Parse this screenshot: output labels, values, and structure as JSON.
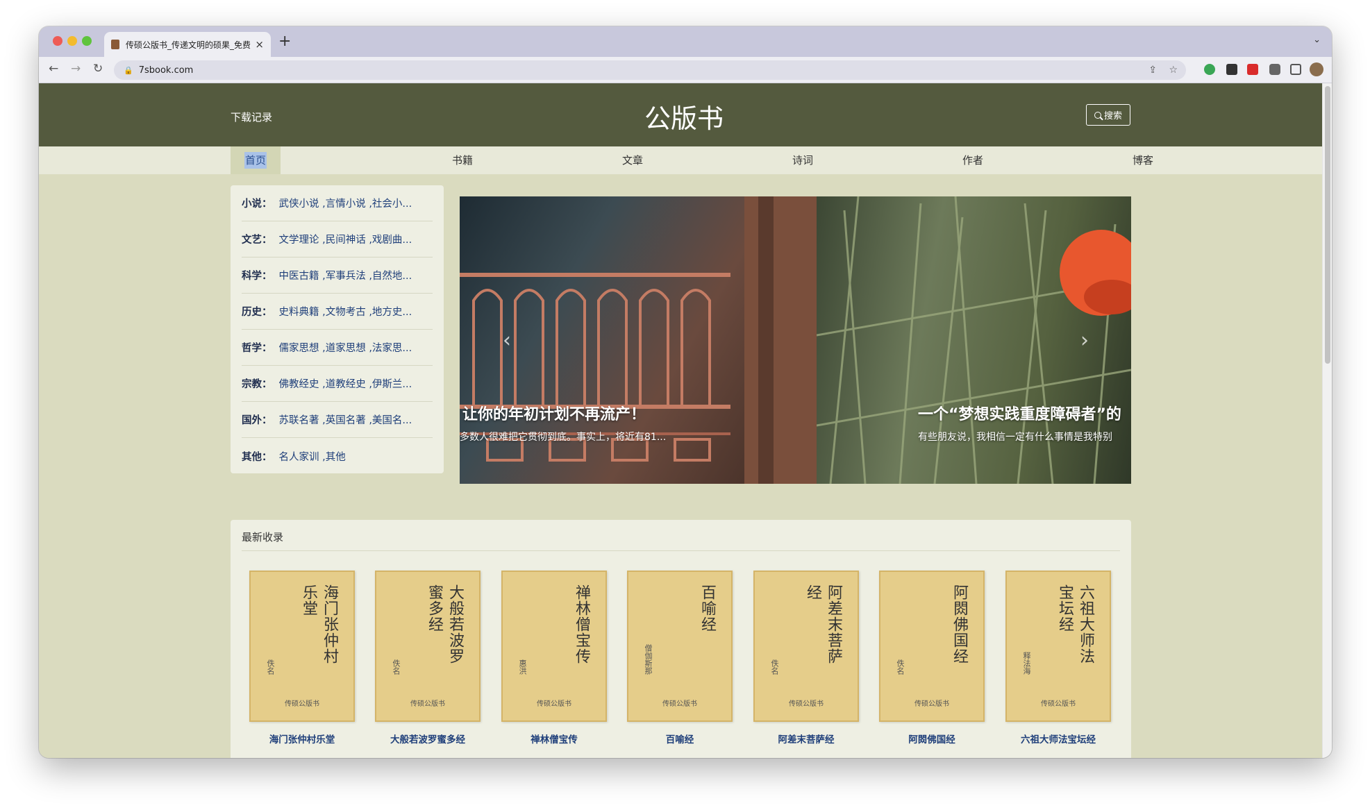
{
  "browser": {
    "tab_title": "传硕公版书_传递文明的硕果_免费",
    "tab_close": "×",
    "new_tab": "+",
    "tab_menu": "⌄",
    "back": "←",
    "forward": "→",
    "reload": "↻",
    "lock": "🔒",
    "url": "7sbook.com",
    "share": "⇪",
    "star": "☆",
    "menu": "⋮"
  },
  "header": {
    "download_label": "下载记录",
    "logo": "公版书",
    "search_label": "搜索"
  },
  "nav": [
    {
      "label": "首页",
      "active": true
    },
    {
      "label": "书籍"
    },
    {
      "label": "文章"
    },
    {
      "label": "诗词"
    },
    {
      "label": "作者"
    },
    {
      "label": "博客"
    }
  ],
  "categories": [
    {
      "name": "小说：",
      "items": "武侠小说 ,言情小说 ,社会小..."
    },
    {
      "name": "文艺：",
      "items": "文学理论 ,民间神话 ,戏剧曲..."
    },
    {
      "name": "科学：",
      "items": "中医古籍 ,军事兵法 ,自然地..."
    },
    {
      "name": "历史：",
      "items": "史料典籍 ,文物考古 ,地方史..."
    },
    {
      "name": "哲学：",
      "items": "儒家思想 ,道家思想 ,法家思..."
    },
    {
      "name": "宗教：",
      "items": "佛教经史 ,道教经史 ,伊斯兰..."
    },
    {
      "name": "国外：",
      "items": "苏联名著 ,英国名著 ,美国名..."
    },
    {
      "name": "其他：",
      "items": "名人家训 ,其他"
    }
  ],
  "carousel": {
    "prev": "‹",
    "next": "›",
    "slides": [
      {
        "title": "让你的年初计划不再流产！",
        "desc": "多数人很难把它贯彻到底。事实上，将近有81..."
      },
      {
        "title": "一个“梦想实践重度障碍者”的",
        "desc": "有些朋友说，我相信一定有什么事情是我特别"
      }
    ]
  },
  "latest": {
    "title": "最新收录",
    "books": [
      {
        "cover_title": "海门张仲村乐堂",
        "author": "佚名",
        "publisher": "传硕公版书",
        "name": "海门张仲村乐堂"
      },
      {
        "cover_title": "大般若波罗蜜多经",
        "author": "佚名",
        "publisher": "传硕公版书",
        "name": "大般若波罗蜜多经"
      },
      {
        "cover_title": "禅林僧宝传",
        "author": "惠洪",
        "publisher": "传硕公版书",
        "name": "禅林僧宝传"
      },
      {
        "cover_title": "百喻经",
        "author": "僧伽斯那",
        "publisher": "传硕公版书",
        "name": "百喻经"
      },
      {
        "cover_title": "阿差末菩萨经",
        "author": "佚名",
        "publisher": "传硕公版书",
        "name": "阿差末菩萨经"
      },
      {
        "cover_title": "阿閦佛国经",
        "author": "佚名",
        "publisher": "传硕公版书",
        "name": "阿閦佛国经"
      },
      {
        "cover_title": "六祖大师法宝坛经",
        "author": "释法海",
        "publisher": "传硕公版书",
        "name": "六祖大师法宝坛经"
      }
    ]
  }
}
